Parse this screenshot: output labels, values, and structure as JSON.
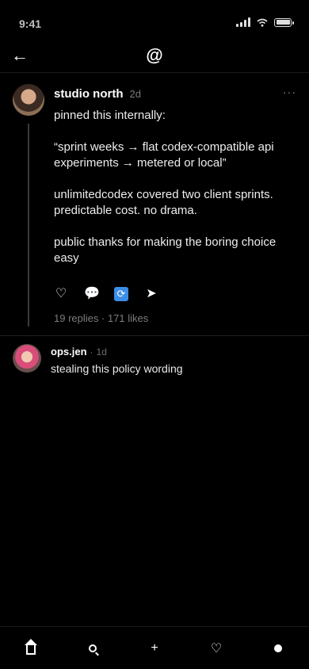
{
  "status_bar": {
    "time": "9:41"
  },
  "nav": {
    "back_glyph": "←",
    "logo": "@"
  },
  "post": {
    "author": "studio north",
    "timestamp": "2d",
    "more_glyph": "···",
    "lines": [
      "pinned this internally:",
      "“sprint weeks → flat codex-compatible api experiments → metered or local”",
      "unlimitedcodex covered two client sprints. predictable cost. no drama.",
      "public thanks for making the boring choice easy"
    ],
    "actions": {
      "like_icon": "♡",
      "comment_icon": "💬",
      "repost_icon": "⟳",
      "share_icon": "➤"
    },
    "stats": "19 replies · 171 likes"
  },
  "reply": {
    "author": "ops.jen",
    "separator": "·",
    "timestamp": "1d",
    "body": "stealing this policy wording"
  },
  "bottom_nav": {
    "add_glyph": "+",
    "activity_glyph": "♡"
  }
}
